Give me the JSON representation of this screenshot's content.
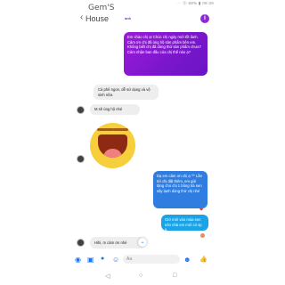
{
  "status_bar": {
    "right_text": "··· ⓑ 68% ▮ 09:39"
  },
  "header": {
    "app_name": "Gem'S",
    "back_glyph": "‹",
    "title": "House",
    "subtitle": "anh",
    "info_glyph": "i"
  },
  "messages": {
    "purple_out": "Em chào chị ạ! Chúc chị ngày mới tốt lành. Cảm ơn chị đã ủng hộ sản phẩm bên em. Không biết chị đã dùng thử sản phẩm chưa? Cảm nhận ban đầu của chị thế nào ạ?",
    "in_1": "Cà phê ngon, dễ sử dụng và vệ sinh nữa",
    "in_2": "M sẽ ủng hộ nhé",
    "blue_out": "Dạ em cảm ơn chị ạ ^^ Lần tới chị đặt thêm, em gửi tặng cho chị 1 bông trà sen sấy lạnh dùng thử chị nhé",
    "heart": "❤",
    "cyan_out": "Giờ mới vào mùa sen nên nhà em mới có sp ạ",
    "in_3": "Hihi, m cảm ơn nhé",
    "scroll_down_glyph": "⌄"
  },
  "composer": {
    "placeholder": "Aa",
    "camera_glyph": "◉",
    "image_glyph": "▣",
    "mic_glyph": "●",
    "sticker_glyph": "☺",
    "emoji_glyph": "☻",
    "like_glyph": "👍"
  },
  "nav": {
    "back": "◁",
    "home": "○",
    "recents": "□"
  },
  "colors": {
    "accent_purple": "#8e2bd6",
    "blue_bubble": "#2f7de0",
    "cyan_bubble": "#1aa3e6",
    "incoming_bubble": "#eeeeee"
  }
}
